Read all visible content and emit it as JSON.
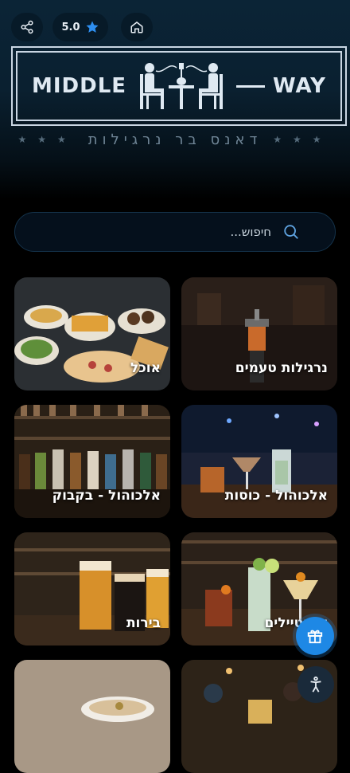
{
  "header": {
    "rating": "5.0",
    "share_icon": "share-icon",
    "star_icon": "star-icon",
    "home_icon": "home-icon"
  },
  "logo": {
    "left_word": "MIDDLE",
    "right_word": "WAY",
    "subtitle": "דאנס בר נרגילות"
  },
  "search": {
    "placeholder": "חיפוש..."
  },
  "categories": [
    {
      "label": "נרגילות טעמים"
    },
    {
      "label": "אוכל"
    },
    {
      "label": "אלכוהול - כוסות"
    },
    {
      "label": "אלכוהול - בקבוק"
    },
    {
      "label": "קוקטיילים"
    },
    {
      "label": "בירות"
    },
    {
      "label": ""
    },
    {
      "label": ""
    }
  ],
  "colors": {
    "accent": "#1e88e5",
    "background": "#000000",
    "hero_top": "#0b2436"
  }
}
